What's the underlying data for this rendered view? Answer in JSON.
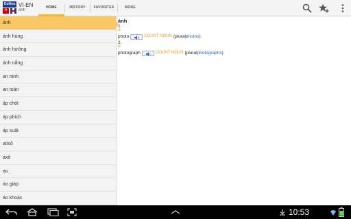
{
  "app": {
    "title": "VI-EN",
    "subtitle": "ánh",
    "logo_text": "Collins"
  },
  "tabs": [
    {
      "label": "HOME",
      "active": true
    },
    {
      "label": "HISTORY",
      "active": false
    },
    {
      "label": "FAVORITES",
      "active": false
    },
    {
      "label": "MORE",
      "active": false
    }
  ],
  "actions": [
    "search-icon",
    "star-add-icon",
    "overflow-menu-icon"
  ],
  "word_list": [
    "ánh",
    "ánh hùng",
    "ánh hưởng",
    "ánh nắng",
    "an ninh",
    "an toàn",
    "áp chót",
    "áp phích",
    "áp suất",
    "atisô",
    "axit",
    "ao",
    "áo giáp",
    "áo khoác"
  ],
  "entry": {
    "headword": "ánh",
    "senses": [
      {
        "number": "1.",
        "bullet": "¤",
        "word": "photo",
        "pos": "COUNT NOUN",
        "plural_prefix": "(plural ",
        "plural": "photos",
        "plural_suffix": ")"
      },
      {
        "number": "2.",
        "bullet": "¤",
        "word": "photograph",
        "pos": "COUNT NOUN",
        "plural_prefix": "(plural ",
        "plural": "photographs",
        "plural_suffix": ")"
      }
    ]
  },
  "status_bar": {
    "time": "10:53"
  },
  "colors": {
    "accent": "#f6b233",
    "selected_row": "#f8c864",
    "pos_orange": "#f29a1f",
    "link_blue": "#2a62c9"
  }
}
